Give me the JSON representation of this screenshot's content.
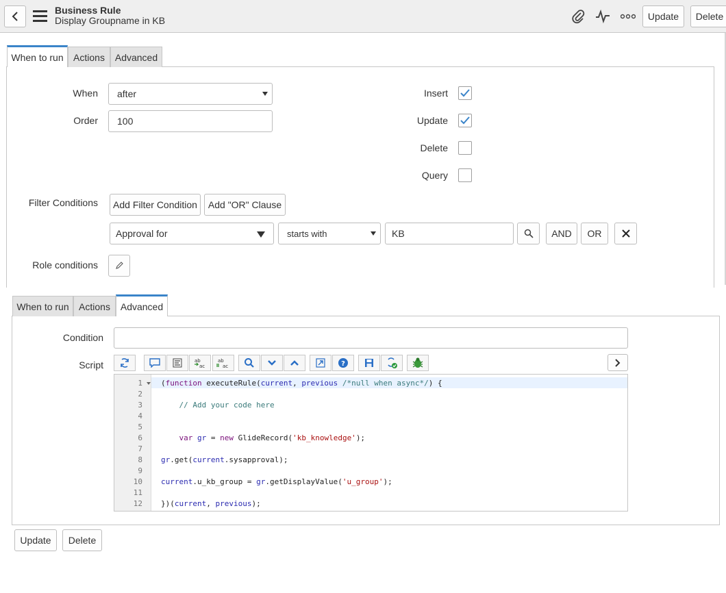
{
  "header": {
    "title": "Business Rule",
    "subtitle": "Display Groupname in KB",
    "update_label": "Update",
    "delete_label": "Delete"
  },
  "tabs_top": [
    "When to run",
    "Actions",
    "Advanced"
  ],
  "tabs_bottom": [
    "When to run",
    "Actions",
    "Advanced"
  ],
  "when_to_run": {
    "when_label": "When",
    "when_value": "after",
    "order_label": "Order",
    "order_value": "100",
    "insert_label": "Insert",
    "insert_checked": true,
    "update_label": "Update",
    "update_checked": true,
    "delete_label": "Delete",
    "delete_checked": false,
    "query_label": "Query",
    "query_checked": false,
    "filter_label": "Filter Conditions",
    "add_filter_label": "Add Filter Condition",
    "add_or_label": "Add \"OR\" Clause",
    "filter_field": "Approval for",
    "filter_operator": "starts with",
    "filter_value": "KB",
    "and_label": "AND",
    "or_label": "OR",
    "role_label": "Role conditions"
  },
  "advanced": {
    "condition_label": "Condition",
    "condition_value": "",
    "script_label": "Script",
    "script_lines": [
      {
        "n": "1",
        "text": "(function executeRule(current, previous /*null when async*/) {"
      },
      {
        "n": "2",
        "text": ""
      },
      {
        "n": "3",
        "text": "    // Add your code here"
      },
      {
        "n": "4",
        "text": ""
      },
      {
        "n": "5",
        "text": ""
      },
      {
        "n": "6",
        "text": "    var gr = new GlideRecord('kb_knowledge');"
      },
      {
        "n": "7",
        "text": ""
      },
      {
        "n": "8",
        "text": "gr.get(current.sysapproval);"
      },
      {
        "n": "9",
        "text": ""
      },
      {
        "n": "10",
        "text": "current.u_kb_group = gr.getDisplayValue('u_group');"
      },
      {
        "n": "11",
        "text": ""
      },
      {
        "n": "12",
        "text": "})(current, previous);"
      }
    ]
  },
  "footer": {
    "update_label": "Update",
    "delete_label": "Delete"
  },
  "colors": {
    "accent": "#3a84c9",
    "header_bg": "#efefef",
    "active_line": "#e8f2ff"
  }
}
